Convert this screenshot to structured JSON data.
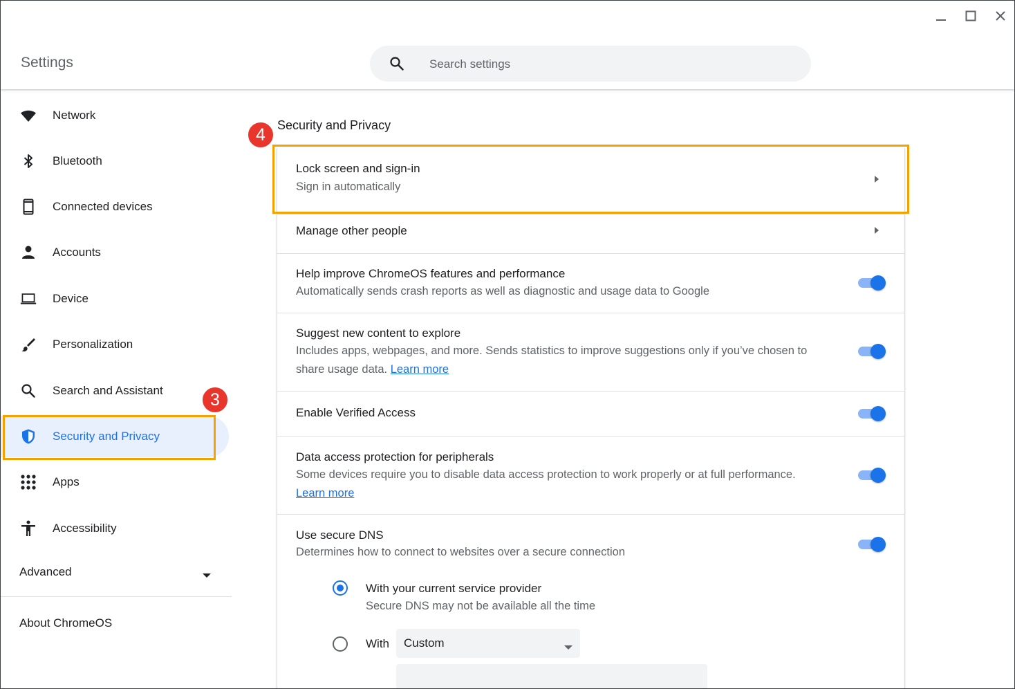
{
  "window": {
    "title": "Settings",
    "controls": [
      "minimize-icon",
      "maximize-icon",
      "close-icon"
    ]
  },
  "search": {
    "placeholder": "Search settings",
    "value": ""
  },
  "sidebar": {
    "items": [
      {
        "label": "Network",
        "icon": "wifi-icon"
      },
      {
        "label": "Bluetooth",
        "icon": "bluetooth-icon"
      },
      {
        "label": "Connected devices",
        "icon": "phone-icon"
      },
      {
        "label": "Accounts",
        "icon": "person-icon"
      },
      {
        "label": "Device",
        "icon": "laptop-icon"
      },
      {
        "label": "Personalization",
        "icon": "brush-icon"
      },
      {
        "label": "Search and Assistant",
        "icon": "search-icon"
      },
      {
        "label": "Security and Privacy",
        "icon": "shield-icon",
        "active": true
      },
      {
        "label": "Apps",
        "icon": "apps-grid-icon"
      },
      {
        "label": "Accessibility",
        "icon": "accessibility-icon"
      }
    ],
    "advanced_label": "Advanced",
    "about_label": "About ChromeOS"
  },
  "annotations": {
    "badge_sidebar": "3",
    "badge_main": "4",
    "highlight_color": "#f5a200",
    "badge_color": "#e8362c"
  },
  "main": {
    "section_title": "Security and Privacy",
    "lock_screen": {
      "title": "Lock screen and sign-in",
      "subtitle": "Sign in automatically"
    },
    "manage_people": {
      "title": "Manage other people"
    },
    "help_improve": {
      "title": "Help improve ChromeOS features and performance",
      "subtitle": "Automatically sends crash reports as well as diagnostic and usage data to Google",
      "enabled": true
    },
    "suggest_content": {
      "title": "Suggest new content to explore",
      "subtitle_line1": "Includes apps, webpages, and more. Sends statistics to improve suggestions only if you’ve chosen to",
      "subtitle_line2": "share usage data.",
      "link": "Learn more",
      "enabled": true
    },
    "verified_access": {
      "title": "Enable Verified Access",
      "enabled": true
    },
    "data_access": {
      "title": "Data access protection for peripherals",
      "subtitle": "Some devices require you to disable data access protection to work properly or at full performance.",
      "link": "Learn more",
      "enabled": true
    },
    "secure_dns": {
      "title": "Use secure DNS",
      "subtitle": "Determines how to connect to websites over a secure connection",
      "enabled": true,
      "option_current": {
        "title": "With your current service provider",
        "subtitle": "Secure DNS may not be available all the time",
        "selected": true
      },
      "option_custom": {
        "label": "With",
        "selected": false,
        "select_value": "Custom",
        "custom_input_value": ""
      }
    }
  },
  "colors": {
    "accent": "#1a73e8",
    "accent_light": "#8ab4f8",
    "active_bg": "#e8f0fe",
    "text_secondary": "#5f6368"
  }
}
